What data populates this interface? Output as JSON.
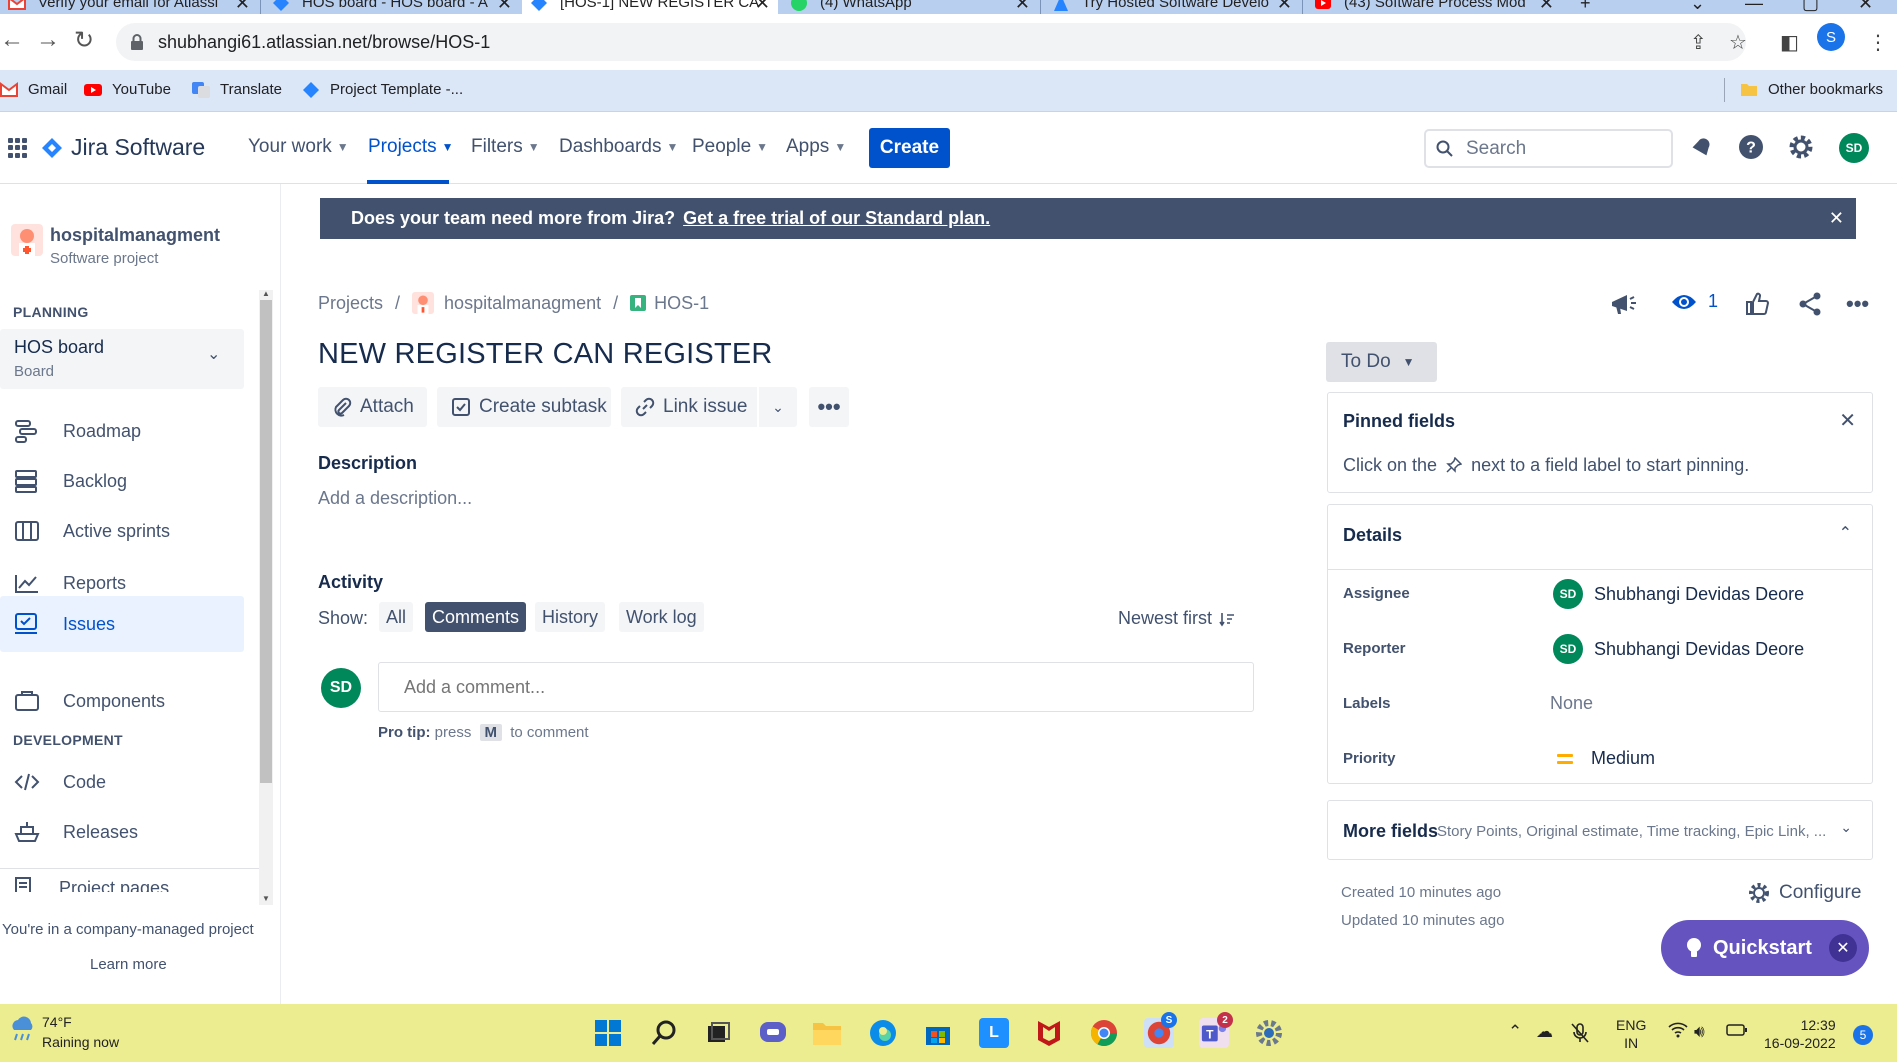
{
  "browser": {
    "tabs": [
      {
        "title": "Verify your email for Atlassi",
        "active": false
      },
      {
        "title": "HOS board - HOS board - A",
        "active": false
      },
      {
        "title": "[HOS-1] NEW REGISTER CA",
        "active": true
      },
      {
        "title": "(4) WhatsApp",
        "active": false
      },
      {
        "title": "Try Hosted Software Develo",
        "active": false
      },
      {
        "title": "(43) Software Process Mod",
        "active": false
      }
    ],
    "url": "shubhangi61.atlassian.net/browse/HOS-1",
    "profile_initial": "S",
    "bookmarks": [
      "Gmail",
      "YouTube",
      "Translate",
      "Project Template -..."
    ],
    "other_bookmarks": "Other bookmarks"
  },
  "jira": {
    "product_name": "Jira Software",
    "menu": [
      {
        "label": "Your work"
      },
      {
        "label": "Projects"
      },
      {
        "label": "Filters"
      },
      {
        "label": "Dashboards"
      },
      {
        "label": "People"
      },
      {
        "label": "Apps"
      }
    ],
    "create_label": "Create",
    "search_placeholder": "Search",
    "user_initials": "SD"
  },
  "sidebar": {
    "project_name": "hospitalmanagment",
    "project_type": "Software project",
    "planning_header": "PLANNING",
    "board_name": "HOS board",
    "board_sub": "Board",
    "planning_items": [
      {
        "label": "Roadmap",
        "icon": "roadmap-icon"
      },
      {
        "label": "Backlog",
        "icon": "backlog-icon"
      },
      {
        "label": "Active sprints",
        "icon": "active-sprints-icon"
      },
      {
        "label": "Reports",
        "icon": "reports-icon"
      }
    ],
    "issues_label": "Issues",
    "components_label": "Components",
    "development_header": "DEVELOPMENT",
    "dev_items": [
      {
        "label": "Code",
        "icon": "code-icon"
      },
      {
        "label": "Releases",
        "icon": "releases-icon"
      }
    ],
    "project_pages_label": "Project pages",
    "managed_text": "You're in a company-managed project",
    "learn_more": "Learn more"
  },
  "banner": {
    "text": "Does your team need more from Jira?",
    "link": "Get a free trial of our Standard plan."
  },
  "issue": {
    "breadcrumb_projects": "Projects",
    "breadcrumb_project": "hospitalmanagment",
    "key": "HOS-1",
    "title": "NEW REGISTER CAN REGISTER",
    "watch_count": "1",
    "actions": {
      "attach": "Attach",
      "create_subtask": "Create subtask",
      "link_issue": "Link issue"
    },
    "description_header": "Description",
    "description_placeholder": "Add a description...",
    "activity_header": "Activity",
    "show_label": "Show:",
    "filters": [
      "All",
      "Comments",
      "History",
      "Work log"
    ],
    "active_filter": "Comments",
    "sort_label": "Newest first",
    "comment_placeholder": "Add a comment...",
    "pro_tip_bold": "Pro tip:",
    "pro_tip_press": "press",
    "pro_tip_key": "M",
    "pro_tip_rest": "to comment"
  },
  "right_panel": {
    "status": "To Do",
    "pinned_title": "Pinned fields",
    "pinned_text_before": "Click on the",
    "pinned_text_after": "next to a field label to start pinning.",
    "details_title": "Details",
    "fields": {
      "assignee_label": "Assignee",
      "assignee": "Shubhangi Devidas Deore",
      "assignee_initials": "SD",
      "reporter_label": "Reporter",
      "reporter": "Shubhangi Devidas Deore",
      "reporter_initials": "SD",
      "labels_label": "Labels",
      "labels": "None",
      "priority_label": "Priority",
      "priority": "Medium"
    },
    "more_fields_title": "More fields",
    "more_fields_sub": "Story Points, Original estimate, Time tracking, Epic Link, ...",
    "created": "Created 10 minutes ago",
    "updated": "Updated 10 minutes ago",
    "configure": "Configure",
    "quickstart": "Quickstart"
  },
  "taskbar": {
    "temp": "74°F",
    "weather": "Raining now",
    "lang_top": "ENG",
    "lang_bottom": "IN",
    "time": "12:39",
    "date": "16-09-2022",
    "notif_count": "5",
    "chrome_badge": "S",
    "teams_badge": "2"
  },
  "colors": {
    "jira_blue": "#0052cc",
    "banner_bg": "#42526e",
    "quickstart_purple": "#6554c0",
    "avatar_green": "#00875a",
    "priority_medium": "#ffab00",
    "taskbar_bg": "#ecec90"
  }
}
